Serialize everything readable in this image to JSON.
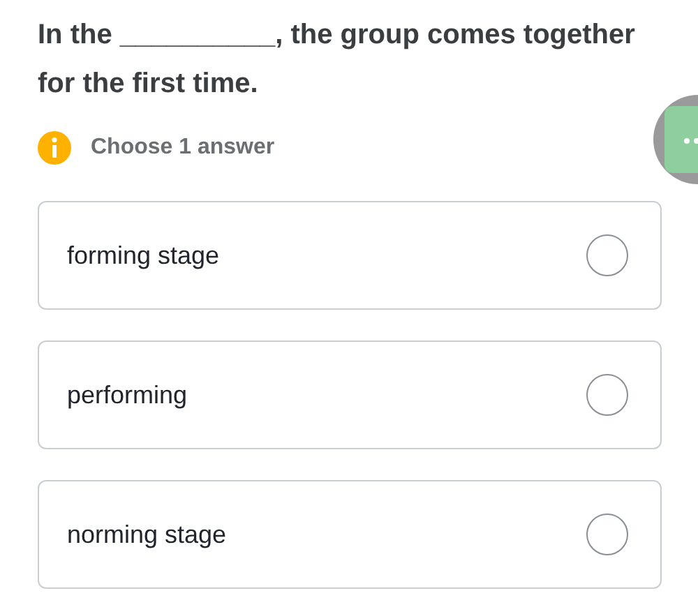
{
  "question": "In the __________, the group comes together for the first time.",
  "hint": "Choose 1 answer",
  "options": [
    {
      "label": "forming stage",
      "selected": false
    },
    {
      "label": "performing",
      "selected": false
    },
    {
      "label": "norming stage",
      "selected": false
    }
  ]
}
